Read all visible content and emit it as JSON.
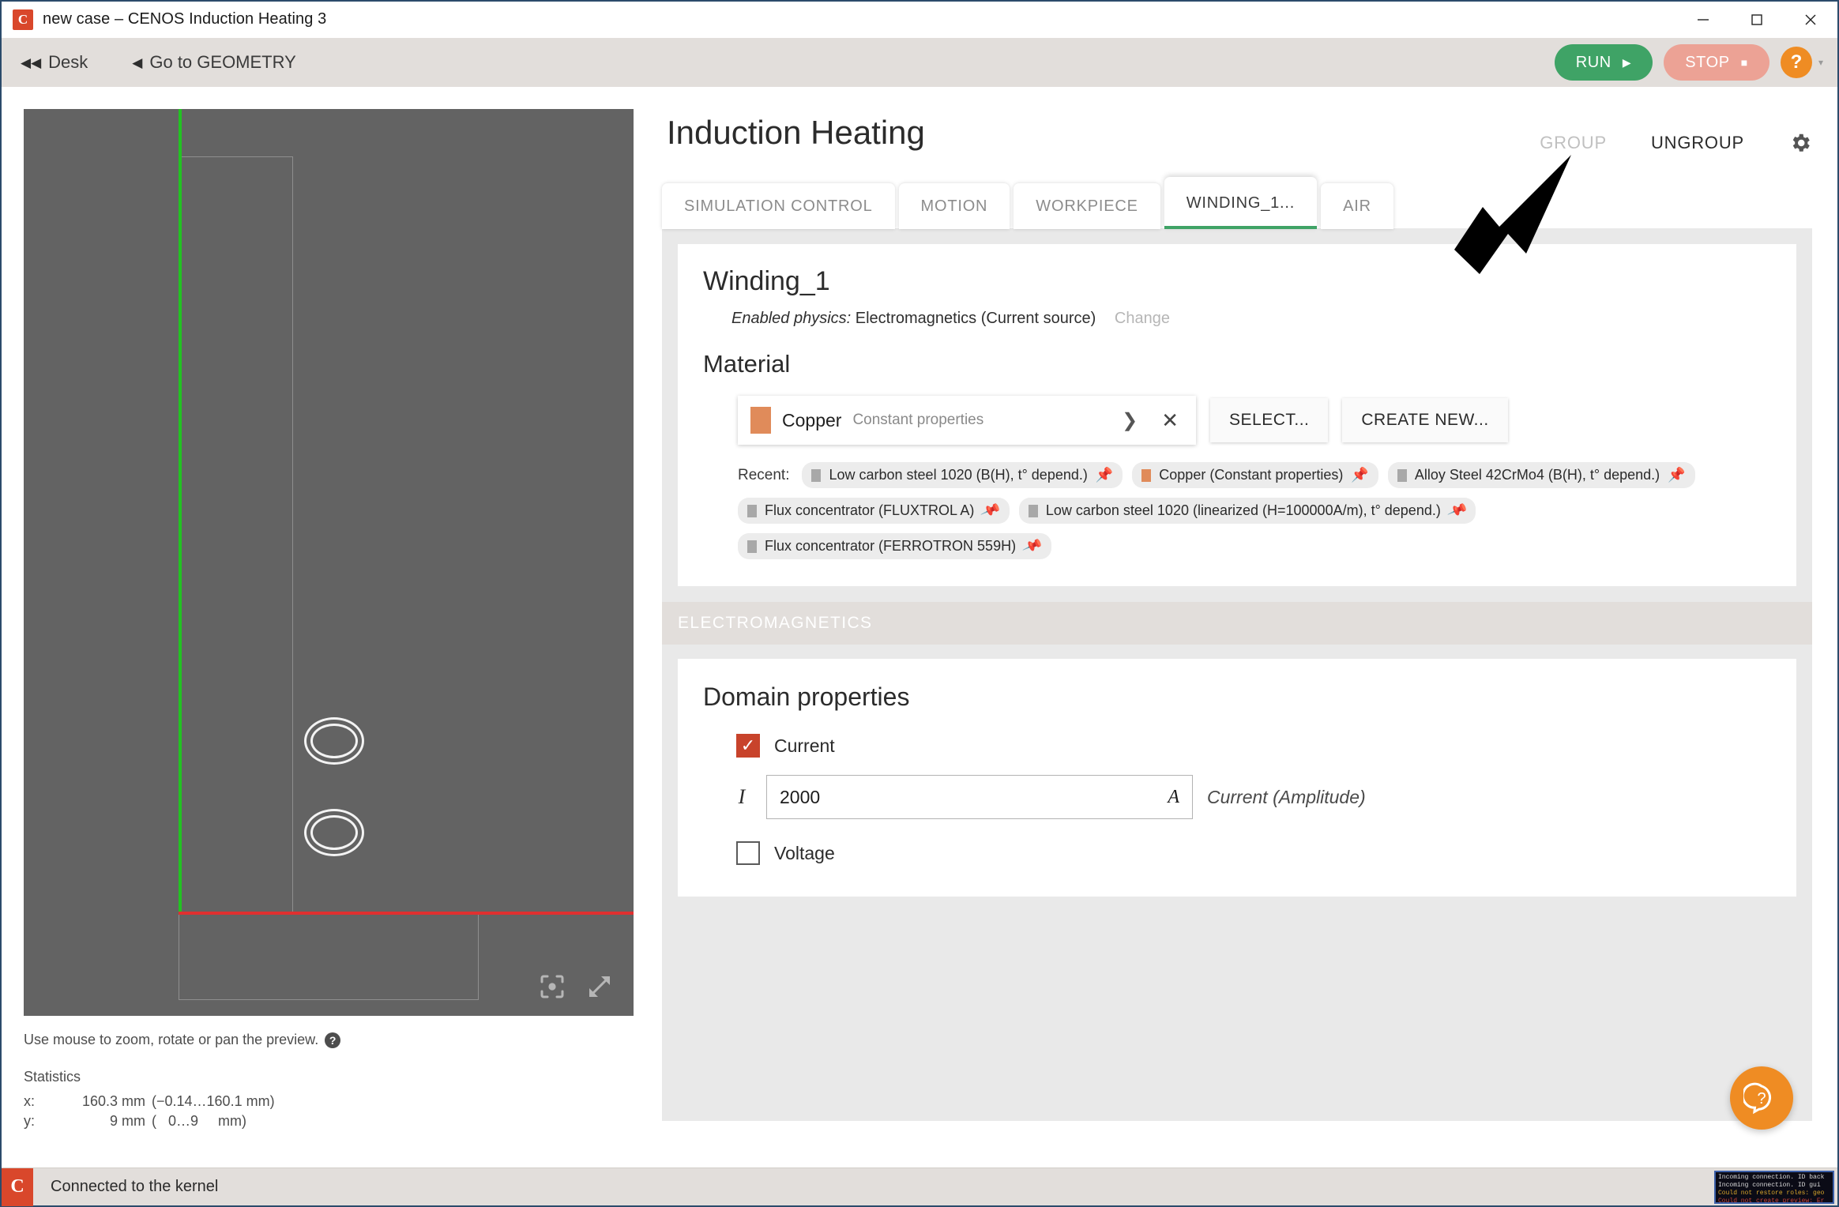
{
  "window": {
    "title": "new case – CENOS Induction Heating 3",
    "app_icon": "cenos-logo-icon",
    "controls": {
      "minimize": "–",
      "maximize": "❐",
      "close": "✕"
    }
  },
  "toolbar": {
    "desk_label": "Desk",
    "desk_arrow": "◀◀",
    "geometry_label": "Go to GEOMETRY",
    "geometry_arrow": "◀",
    "run_label": "RUN",
    "run_glyph": "▶",
    "run_color": "#3fa366",
    "stop_label": "STOP",
    "stop_glyph": "■",
    "stop_color": "#eca295",
    "help_label": "?",
    "help_color": "#ef8c23",
    "help_caret": "▾"
  },
  "preview": {
    "hint": "Use mouse to zoom, rotate or pan the preview.",
    "hint_help": "?",
    "statistics_title": "Statistics",
    "stats": [
      {
        "axis": "x:",
        "value": "160.3 mm",
        "range": "(−0.14…160.1 mm)"
      },
      {
        "axis": "y:",
        "value": "9 mm",
        "range": "(   0…9     mm)"
      }
    ],
    "axis_y_color": "#22c322",
    "axis_x_color": "#e03030",
    "tools": [
      "focus-target-icon",
      "expand-arrows-icon"
    ]
  },
  "main": {
    "title": "Induction Heating",
    "actions": {
      "group_label": "GROUP",
      "ungroup_label": "UNGROUP",
      "settings_icon": "gear-icon"
    },
    "tabs": [
      {
        "label": "SIMULATION CONTROL",
        "active": false
      },
      {
        "label": "MOTION",
        "active": false
      },
      {
        "label": "WORKPIECE",
        "active": false
      },
      {
        "label": "WINDING_1...",
        "active": true
      },
      {
        "label": "AIR",
        "active": false
      }
    ],
    "active_tab_underline_color": "#3fa366"
  },
  "winding": {
    "name": "Winding_1",
    "enabled_physics_label": "Enabled physics:",
    "enabled_physics_value": "Electromagnetics (Current source)",
    "change_label": "Change",
    "material_heading": "Material",
    "selected_material": {
      "name": "Copper",
      "subtitle": "Constant properties",
      "swatch_color": "#e08b5a",
      "expand_icon": "chevron-right-icon",
      "clear_icon": "close-icon"
    },
    "select_button": "SELECT...",
    "create_button": "CREATE NEW...",
    "recent_label": "Recent:",
    "recent_materials": [
      {
        "label": "Low carbon steel 1020 (B(H), t° depend.)",
        "swatch": "#a8a8a8",
        "pinned": true
      },
      {
        "label": "Copper (Constant properties)",
        "swatch": "#e08b5a",
        "pinned": true
      },
      {
        "label": "Alloy Steel 42CrMo4 (B(H), t° depend.)",
        "swatch": "#a8a8a8",
        "pinned": true
      },
      {
        "label": "Flux concentrator (FLUXTROL A)",
        "swatch": "#a8a8a8",
        "pinned": false
      },
      {
        "label": "Low carbon steel 1020 (linearized (H=100000A/m), t° depend.)",
        "swatch": "#a8a8a8",
        "pinned": false
      },
      {
        "label": "Flux concentrator (FERROTRON 559H)",
        "swatch": "#a8a8a8",
        "pinned": false
      }
    ],
    "section_band": "ELECTROMAGNETICS",
    "domain": {
      "heading": "Domain properties",
      "current_label": "Current",
      "current_checked": true,
      "current_symbol": "I",
      "current_value": "2000",
      "current_unit": "A",
      "current_hint": "Current (Amplitude)",
      "voltage_label": "Voltage",
      "voltage_checked": false,
      "checkbox_color": "#c8432b"
    }
  },
  "fab": {
    "icon": "help-bubble-icon",
    "color": "#ef8c23"
  },
  "status": {
    "icon": "cenos-logo-icon",
    "text": "Connected to the kernel",
    "log_lines": [
      {
        "text": "Incoming connection. ID back",
        "color": "white"
      },
      {
        "text": "Incoming connection. ID gui",
        "color": "white"
      },
      {
        "text": "Could not restore roles: geo",
        "color": "yellow"
      },
      {
        "text": "Could not create preview: Er",
        "color": "red"
      }
    ]
  }
}
